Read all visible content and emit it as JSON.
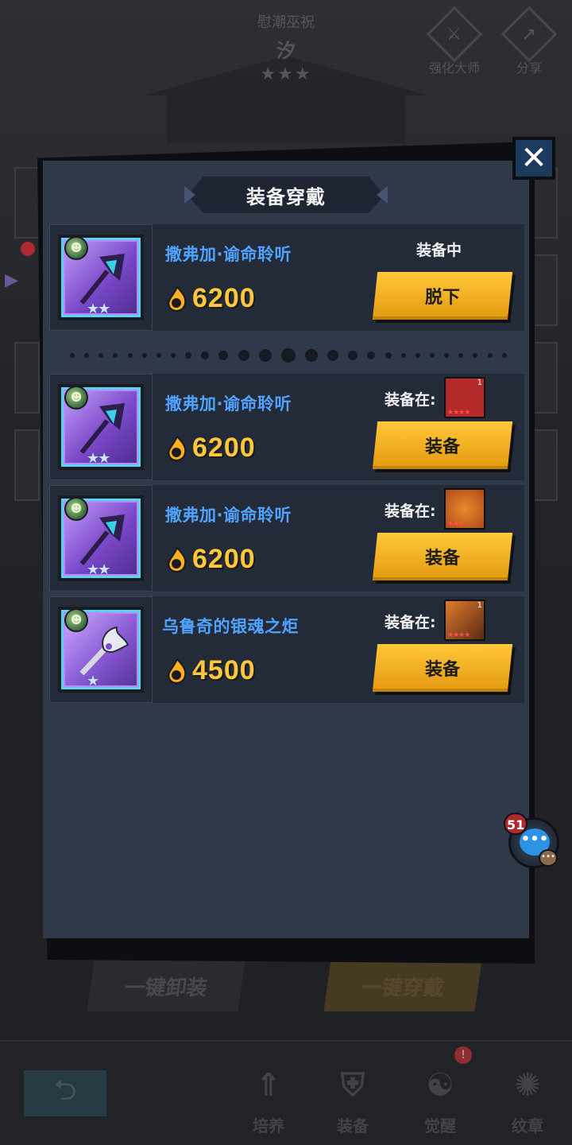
{
  "background": {
    "subtitle": "慰潮巫祝",
    "hero_name": "汐",
    "stars": "★★★",
    "enhance_master_label": "强化大师",
    "share_label": "分享",
    "unequip_all_label": "一键卸装",
    "equip_all_label": "一键穿戴",
    "tabs": [
      {
        "label": "培养",
        "icon": "upgrade-icon"
      },
      {
        "label": "装备",
        "icon": "equipment-icon"
      },
      {
        "label": "觉醒",
        "icon": "awaken-icon"
      },
      {
        "label": "纹章",
        "icon": "emblem-icon"
      }
    ],
    "tab_badge": "!"
  },
  "modal": {
    "title": "装备穿戴",
    "close_glyph": "✕",
    "current": {
      "name": "撒弗加·谕命聆听",
      "power": "6200",
      "status": "装备中",
      "button": "脱下",
      "stars": "★★"
    },
    "items": [
      {
        "name": "撒弗加·谕命聆听",
        "power": "6200",
        "equipped_on_label": "装备在:",
        "hero_level": "1",
        "hero_stars": "★★★★",
        "hero_color": "#b42a2a",
        "button": "装备",
        "stars": "★★"
      },
      {
        "name": "撒弗加·谕命聆听",
        "power": "6200",
        "equipped_on_label": "装备在:",
        "hero_level": "",
        "hero_stars": "★★★",
        "hero_color": "#d46a1e",
        "button": "装备",
        "stars": "★★"
      },
      {
        "name": "乌鲁奇的银魂之炬",
        "power": "4500",
        "equipped_on_label": "装备在:",
        "hero_level": "1",
        "hero_stars": "★★★★",
        "hero_color": "#c8641e",
        "button": "装备",
        "stars": "★"
      }
    ]
  },
  "chat": {
    "count": "51",
    "icon": "chat-bubble-icon"
  },
  "colors": {
    "item_name": "#4fa3ff",
    "power": "#ffc83a",
    "button": "#ffc73a",
    "panel": "#30394a"
  }
}
